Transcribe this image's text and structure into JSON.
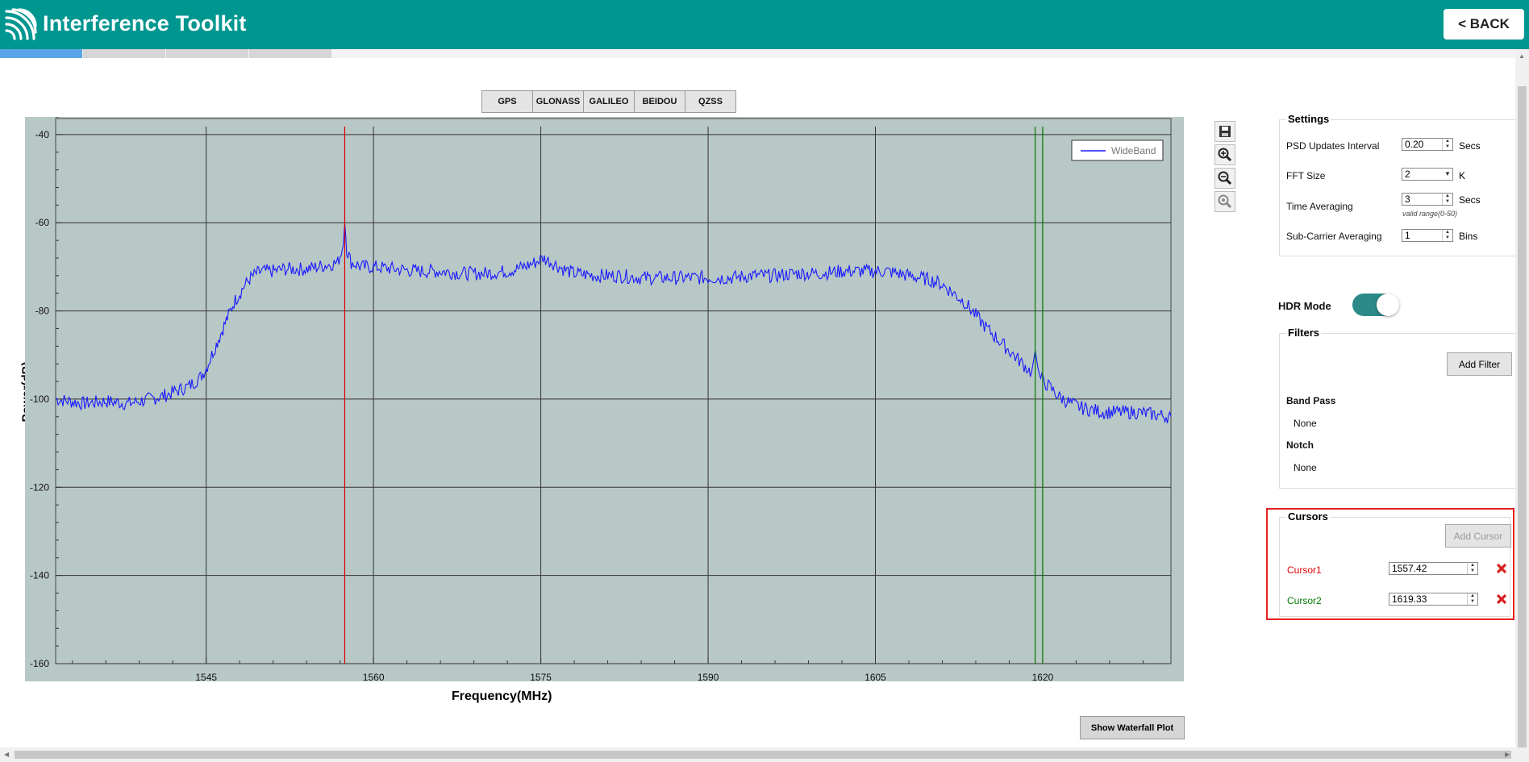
{
  "header": {
    "title": "Interference Toolkit",
    "back_label": "<  BACK",
    "colors": {
      "brand": "#009690"
    }
  },
  "tabs": [
    {
      "active": true
    },
    {
      "active": false
    },
    {
      "active": false
    },
    {
      "active": false
    }
  ],
  "constellations": [
    "GPS",
    "GLONASS",
    "GALILEO",
    "BEIDOU",
    "QZSS"
  ],
  "plot": {
    "ylabel": "Power(dB)",
    "xlabel": "Frequency(MHz)",
    "legend": "WideBand",
    "show_waterfall_label": "Show Waterfall Plot"
  },
  "toolbar": {
    "icons": [
      "save-icon",
      "zoom-in-icon",
      "zoom-out-icon",
      "zoom-reset-icon"
    ]
  },
  "settings": {
    "title": "Settings",
    "psd_label": "PSD Updates Interval",
    "psd_value": "0.20",
    "psd_unit": "Secs",
    "fft_label": "FFT Size",
    "fft_value": "2",
    "fft_unit": "K",
    "time_avg_label": "Time Averaging",
    "time_avg_value": "3",
    "time_avg_unit": "Secs",
    "time_avg_hint": "valid range(0-50)",
    "subcarrier_label": "Sub-Carrier Averaging",
    "subcarrier_value": "1",
    "subcarrier_unit": "Bins"
  },
  "hdr": {
    "label": "HDR Mode",
    "on": true
  },
  "filters": {
    "title": "Filters",
    "add_label": "Add Filter",
    "band_pass_label": "Band Pass",
    "band_pass_value": "None",
    "notch_label": "Notch",
    "notch_value": "None"
  },
  "cursors": {
    "title": "Cursors",
    "add_label": "Add Cursor",
    "items": [
      {
        "name": "Cursor1",
        "value": "1557.42",
        "color": "#e00000"
      },
      {
        "name": "Cursor2",
        "value": "1619.33",
        "color": "#007a00"
      }
    ]
  },
  "chart_data": {
    "type": "line",
    "xlabel": "Frequency(MHz)",
    "ylabel": "Power(dB)",
    "xlim": [
      1531.5,
      1631.5
    ],
    "ylim": [
      -160,
      -36
    ],
    "x_ticks": [
      1545,
      1560,
      1575,
      1590,
      1605,
      1620
    ],
    "y_ticks": [
      -40,
      -60,
      -80,
      -100,
      -120,
      -140,
      -160
    ],
    "grid": true,
    "legend": "top-right",
    "series": [
      {
        "name": "WideBand",
        "color": "#1a1aff",
        "x": [
          1531.5,
          1534,
          1536,
          1538,
          1540,
          1541.5,
          1542.5,
          1543.5,
          1544.5,
          1545,
          1545.5,
          1546,
          1546.5,
          1547,
          1547.5,
          1548,
          1548.5,
          1549,
          1549.5,
          1550,
          1551,
          1552,
          1553,
          1554,
          1555,
          1556,
          1556.8,
          1557.3,
          1557.42,
          1557.6,
          1558,
          1559,
          1560,
          1562,
          1564,
          1566,
          1568,
          1570,
          1572,
          1573.5,
          1574.5,
          1575.2,
          1576,
          1577,
          1578,
          1580,
          1582,
          1584,
          1586,
          1588,
          1590,
          1592,
          1594,
          1596,
          1598,
          1600,
          1602,
          1604,
          1606,
          1607,
          1608,
          1609,
          1610,
          1611,
          1612,
          1613,
          1614,
          1615,
          1616,
          1617,
          1618,
          1619,
          1619.33,
          1619.7,
          1620.5,
          1621.5,
          1622.5,
          1623.5,
          1624.5,
          1625.5,
          1627,
          1628.5,
          1630,
          1631.5
        ],
        "y": [
          -100,
          -101,
          -100.5,
          -101,
          -100,
          -99,
          -98,
          -97,
          -95,
          -93,
          -90,
          -87,
          -84,
          -81,
          -78,
          -76,
          -74,
          -72.5,
          -71.5,
          -71,
          -71,
          -70.5,
          -70.5,
          -70.5,
          -70,
          -69.5,
          -69,
          -65,
          -60,
          -66,
          -69,
          -70,
          -70,
          -70.5,
          -71,
          -71,
          -71.5,
          -71.5,
          -71,
          -70,
          -69,
          -68,
          -69,
          -70.5,
          -71.5,
          -72,
          -72,
          -72.5,
          -72.5,
          -72.5,
          -72.5,
          -72.5,
          -72,
          -72,
          -71.5,
          -71.5,
          -71,
          -71,
          -71,
          -71.5,
          -72,
          -72.5,
          -73,
          -74,
          -76,
          -78,
          -81,
          -84,
          -86.5,
          -89,
          -91.5,
          -94,
          -89,
          -95,
          -97,
          -99.5,
          -101,
          -102,
          -102.5,
          -103,
          -103,
          -103,
          -103.5,
          -104
        ]
      }
    ],
    "cursor_lines": [
      {
        "x": 1557.42,
        "color": "#e00000"
      },
      {
        "x": 1619.33,
        "color": "#007a00"
      },
      {
        "x": 1620,
        "color": "#007a00"
      }
    ]
  }
}
